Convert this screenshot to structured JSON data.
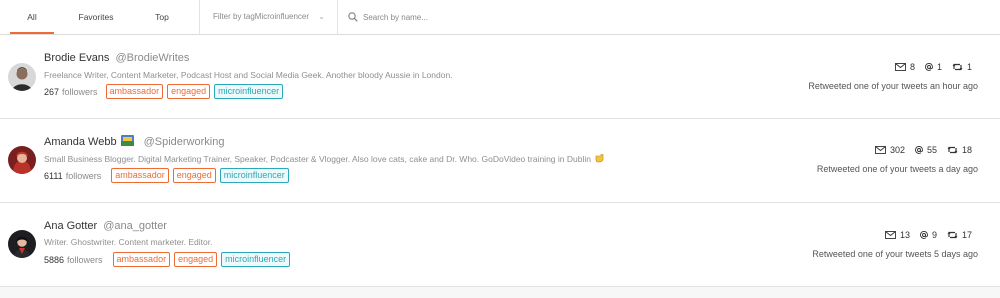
{
  "tabs": [
    {
      "label": "All",
      "active": true
    },
    {
      "label": "Favorites",
      "active": false
    },
    {
      "label": "Top",
      "active": false
    }
  ],
  "filter": {
    "label": "Filter by tag",
    "value": "Microinfluencer"
  },
  "search": {
    "placeholder": "Search by name...",
    "value": ""
  },
  "followers_label": "followers",
  "accent_color": "#f06a35",
  "tag_colors": {
    "orange": "#f06a35",
    "teal": "#2aa9b8"
  },
  "rows": [
    {
      "name": "Brodie Evans",
      "handle": "@BrodieWrites",
      "bio": "Freelance Writer, Content Marketer, Podcast Host and Social Media Geek. Another bloody Aussie in London.",
      "followers": "267",
      "tags": [
        "ambassador",
        "engaged",
        "microinfluencer"
      ],
      "stats": {
        "messages": "8",
        "mentions": "1",
        "retweets": "1"
      },
      "activity": "Retweeted one of your tweets an hour ago"
    },
    {
      "name": "Amanda Webb",
      "name_emoji": "flag-icon",
      "handle": "@Spiderworking",
      "bio": "Small Business Blogger. Digital Marketing Trainer, Speaker, Podcaster & Vlogger. Also love cats, cake and Dr. Who. GoDoVideo training in Dublin",
      "bio_emoji": "pointing-hand-icon",
      "followers": "6111",
      "tags": [
        "ambassador",
        "engaged",
        "microinfluencer"
      ],
      "stats": {
        "messages": "302",
        "mentions": "55",
        "retweets": "18"
      },
      "activity": "Retweeted one of your tweets a day ago"
    },
    {
      "name": "Ana Gotter",
      "handle": "@ana_gotter",
      "bio": "Writer. Ghostwriter. Content marketer. Editor.",
      "followers": "5886",
      "tags": [
        "ambassador",
        "engaged",
        "microinfluencer"
      ],
      "stats": {
        "messages": "13",
        "mentions": "9",
        "retweets": "17"
      },
      "activity": "Retweeted one of your tweets 5 days ago"
    }
  ]
}
